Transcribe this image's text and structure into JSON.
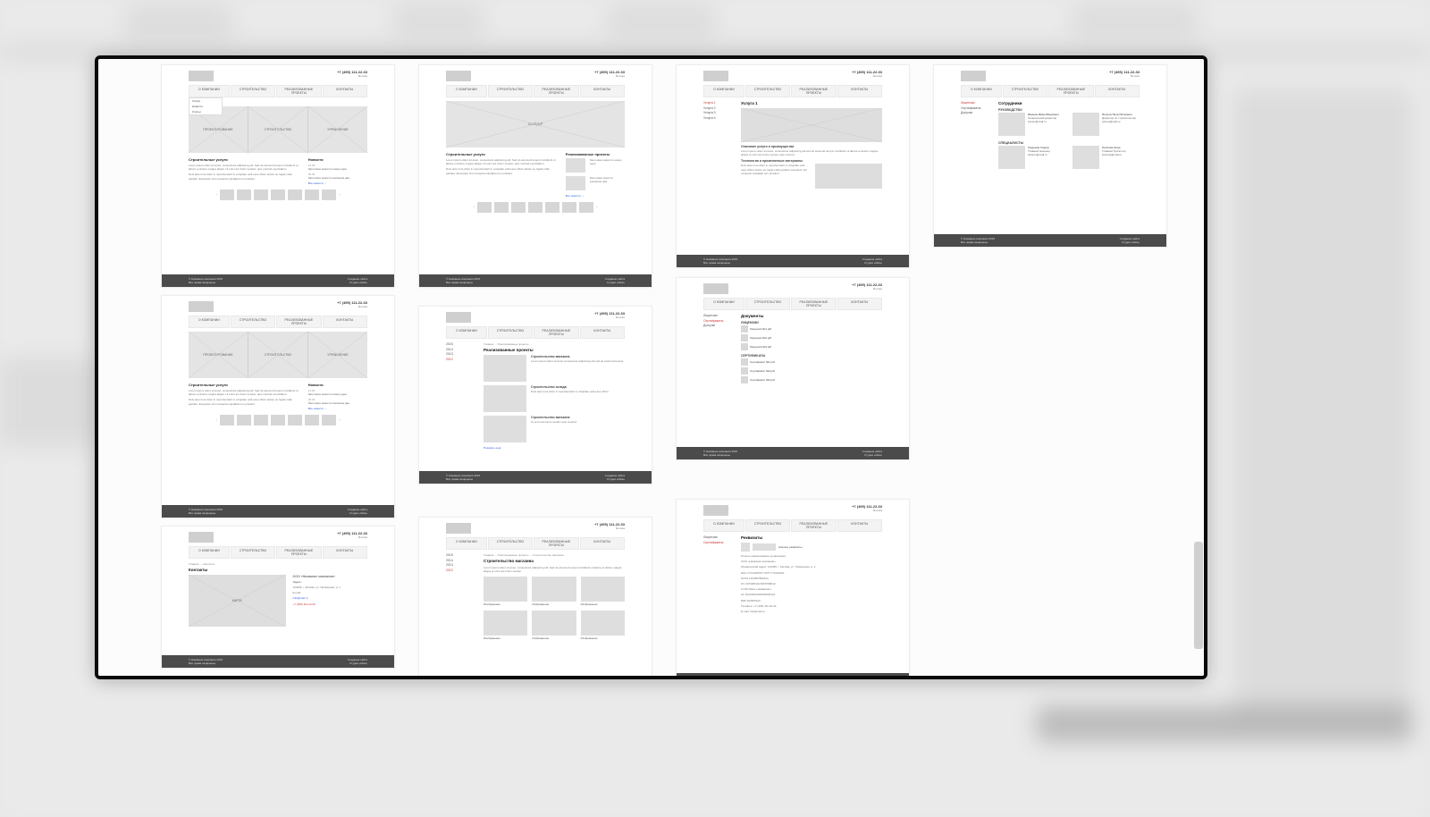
{
  "header": {
    "phone": "+7 (495) 111-22-33",
    "city": "Москва"
  },
  "nav": {
    "items": [
      "О КОМПАНИИ",
      "СТРОИТЕЛЬСТВО",
      "РЕАЛИЗОВАННЫЕ ПРОЕКТЫ",
      "КОНТАКТЫ"
    ]
  },
  "dropdown": [
    "Услуги",
    "Новости",
    "Статьи"
  ],
  "hero_tri": [
    "ПРОЕКТИРОВАНИЕ",
    "СТРОИТЕЛЬСТВО",
    "УПРАВЛЕНИЕ"
  ],
  "hero_single": "СЛАЙДЕР",
  "home": {
    "h": "Строительные услуги",
    "p1": "Lorem ipsum dolor sit amet, consectetur adipiscing elit. Sed do eiusmod tempor incididunt ut labore et dolore magna aliqua. Ut enim ad minim veniam, quis nostrud exercitation.",
    "p2": "Duis aute irure dolor in reprehenderit in voluptate velit esse cillum dolore eu fugiat nulla pariatur. Excepteur sint occaecat cupidatat non proident.",
    "news_h": "Новости",
    "news": [
      {
        "d": "12.06",
        "t": "Заголовок новости номер один"
      },
      {
        "d": "05.06",
        "t": "Заголовок новости компании два"
      }
    ],
    "all": "Все новости →"
  },
  "footer": {
    "l1": "© Название компании 2015",
    "l2": "Все права защищены",
    "r1": "Создание сайта",
    "r2": "Студия «Имя»"
  },
  "service": {
    "side": [
      "Услуга 1",
      "Услуга 2",
      "Услуга 3",
      "Услуга 4"
    ],
    "title": "Услуга 1",
    "sub1": "Описание услуги и преимущества",
    "txt1": "Lorem ipsum dolor sit amet, consectetur adipiscing elit sed do eiusmod tempor incididunt ut labore et dolore magna aliqua ut enim ad minim veniam quis nostrud.",
    "sub2": "Технология и применяемые материалы",
    "txt2": "Duis aute irure dolor in reprehenderit in voluptate velit esse cillum dolore eu fugiat nulla pariatur excepteur sint occaecat cupidatat non proident."
  },
  "staff": {
    "title": "Сотрудники",
    "cat": "РУКОВОДСТВО",
    "people": [
      {
        "n": "Иванов Иван Иванович",
        "r": "Генеральный директор",
        "e": "ivanov@mail.ru"
      },
      {
        "n": "Петров Петр Петрович",
        "r": "Директор по строительству",
        "e": "petrov@mail.ru"
      },
      {
        "n": "Сидоров Сидор",
        "r": "Главный инженер",
        "e": "sidorov@mail.ru"
      },
      {
        "n": "Козлова Анна",
        "r": "Главный бухгалтер",
        "e": "kozlova@mail.ru"
      }
    ],
    "cat2": "СПЕЦИАЛИСТЫ"
  },
  "projects": {
    "side": [
      "2015",
      "2014",
      "2013",
      "2012"
    ],
    "crumb": "Главная → Реализованные проекты",
    "title": "Реализованные проекты",
    "items": [
      {
        "n": "Строительство магазина",
        "t": "Lorem ipsum dolor sit amet consectetur adipiscing elit sed do eiusmod tempor"
      },
      {
        "n": "Строительство склада",
        "t": "Duis aute irure dolor in reprehenderit in voluptate velit esse cillum"
      },
      {
        "n": "Строительство магазина",
        "t": "Ut enim ad minim veniam quis nostrud"
      }
    ],
    "more": "Показать ещё"
  },
  "project_detail": {
    "crumb": "Главная → Реализованные проекты → Строительство магазина",
    "title": "Строительство магазина",
    "txt": "Lorem ipsum dolor sit amet, consectetur adipiscing elit. Sed do eiusmod tempor incididunt ut labore et dolore magna aliqua ut enim ad minim veniam.",
    "imgs": [
      "Изображение",
      "Изображение",
      "Изображение",
      "Изображение",
      "Изображение",
      "Изображение"
    ]
  },
  "docs": {
    "side": [
      "Лицензии",
      "Сертификаты",
      "Допуски"
    ],
    "title": "Документы",
    "g1": "ЛИЦЕНЗИИ",
    "g2": "СЕРТИФИКАТЫ",
    "items1": [
      "Лицензия №1.pdf",
      "Лицензия №2.pdf",
      "Лицензия №3.pdf"
    ],
    "items2": [
      "Сертификат №1.pdf",
      "Сертификат №2.pdf",
      "Сертификат №3.pdf"
    ]
  },
  "req": {
    "title": "Реквизиты",
    "download": "Скачать реквизиты",
    "rows": [
      "Полное наименование организации",
      "ООО «Название компании»",
      "Юридический адрес: 123456, г. Москва, ул. Примерная, д. 1",
      "ИНН 7712345678 / КПП 771201001",
      "ОГРН 1234567890123",
      "Р/с 40702810123456789012",
      "в ПАО Банк «Название»",
      "К/с 30101810000000000123",
      "БИК 044525123",
      "Телефон: +7 (495) 111-22-33",
      "E-mail: info@mail.ru"
    ]
  },
  "contacts": {
    "title": "Контакты",
    "crumb": "Главная → Контакты",
    "map": "КАРТА",
    "org": "ООО «Название компании»",
    "addr": "Адрес:",
    "addrv": "123456, г. Москва, ул. Примерная, д. 1",
    "email_l": "E-mail:",
    "email_v": "info@mail.ru",
    "phone_l": "Телефон:",
    "phone_v": "+7 (495) 111-22-33"
  },
  "rec_projects_h": "Реализованные проекты"
}
